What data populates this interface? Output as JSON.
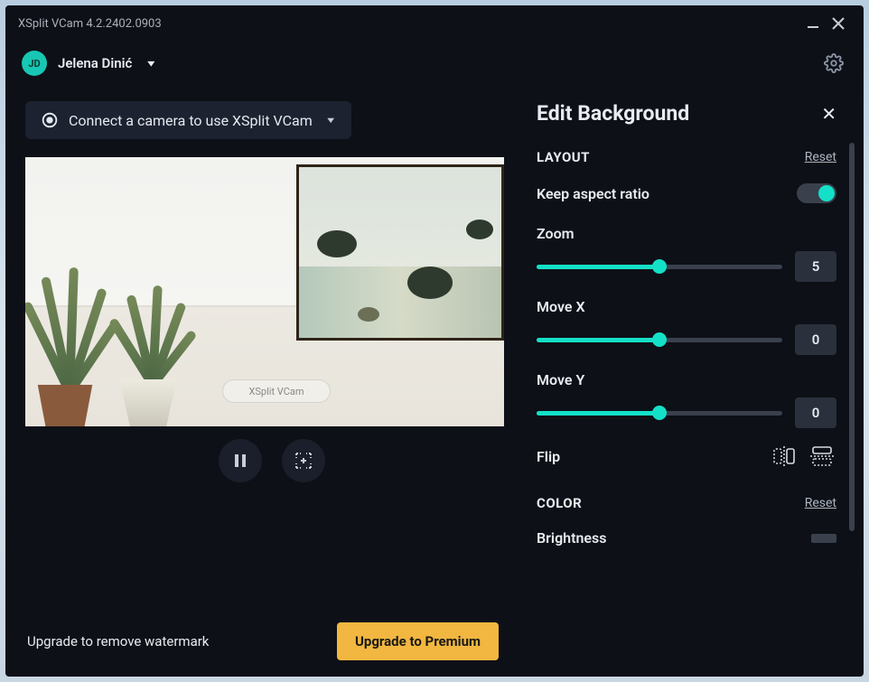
{
  "window": {
    "title": "XSplit VCam 4.2.2402.0903"
  },
  "user": {
    "initials": "JD",
    "name": "Jelena Dinić"
  },
  "camera": {
    "prompt": "Connect a camera to use XSplit VCam"
  },
  "watermark": {
    "label": "XSplit VCam"
  },
  "footer": {
    "message": "Upgrade to remove watermark",
    "button": "Upgrade to Premium"
  },
  "panel": {
    "title": "Edit Background",
    "sections": {
      "layout": {
        "label": "LAYOUT",
        "reset": "Reset"
      },
      "color": {
        "label": "COLOR",
        "reset": "Reset"
      }
    },
    "keep_aspect": {
      "label": "Keep aspect ratio",
      "value": true
    },
    "zoom": {
      "label": "Zoom",
      "value": 5,
      "fill_pct": 50
    },
    "moveX": {
      "label": "Move X",
      "value": 0,
      "fill_pct": 50
    },
    "moveY": {
      "label": "Move Y",
      "value": 0,
      "fill_pct": 50
    },
    "flip": {
      "label": "Flip"
    },
    "brightness": {
      "label": "Brightness"
    }
  }
}
